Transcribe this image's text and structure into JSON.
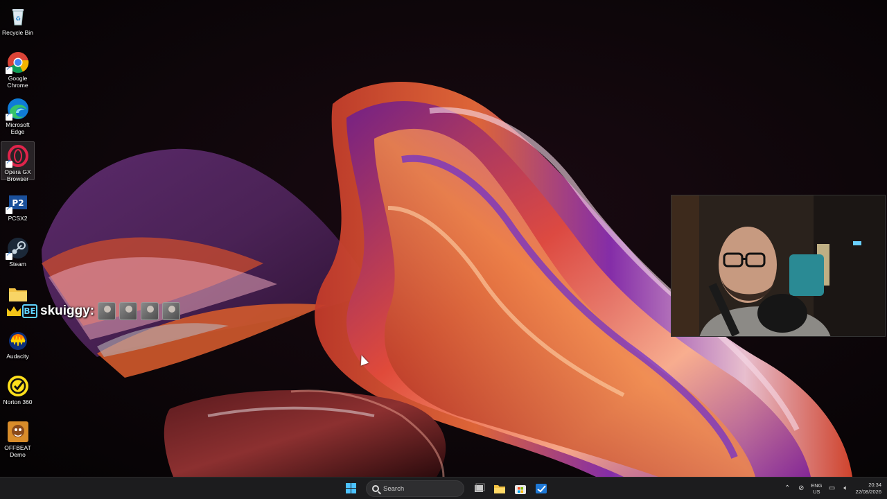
{
  "desktop": {
    "icons": [
      {
        "id": "recycle-bin",
        "label": "Recycle Bin",
        "icon": "recycle-bin-icon",
        "shortcut": false
      },
      {
        "id": "google-chrome",
        "label": "Google Chrome",
        "icon": "chrome-icon",
        "shortcut": true
      },
      {
        "id": "microsoft-edge",
        "label": "Microsoft Edge",
        "icon": "edge-icon",
        "shortcut": true
      },
      {
        "id": "opera-gx",
        "label": "Opera GX Browser",
        "icon": "opera-gx-icon",
        "shortcut": true,
        "selected": true
      },
      {
        "id": "pcsx2",
        "label": "PCSX2",
        "icon": "pcsx2-icon",
        "shortcut": true
      },
      {
        "id": "steam",
        "label": "Steam",
        "icon": "steam-icon",
        "shortcut": true
      },
      {
        "id": "folder",
        "label": "",
        "icon": "folder-icon",
        "shortcut": false
      },
      {
        "id": "audacity",
        "label": "Audacity",
        "icon": "audacity-icon",
        "shortcut": false
      },
      {
        "id": "norton-360",
        "label": "Norton 360",
        "icon": "norton-icon",
        "shortcut": false
      },
      {
        "id": "offbeat-demo",
        "label": "OFFBEAT Demo",
        "icon": "offbeat-icon",
        "shortcut": false
      }
    ]
  },
  "chat_overlay": {
    "badge_text": "BE",
    "username": "skuiggy:",
    "emote_count": 4
  },
  "taskbar": {
    "search_placeholder": "Search",
    "pinned": [
      "task-view-icon",
      "file-explorer-icon",
      "microsoft-store-icon",
      "app-icon"
    ],
    "tray": {
      "language_line1": "ENG",
      "language_line2": "US",
      "time": "20:34",
      "date": "22/08/2026"
    }
  },
  "colors": {
    "taskbar_bg": "#1c1c1e",
    "start_blue": "#4cc2ff",
    "accent_gold": "#f5c518",
    "badge_cyan": "#5fd3ff"
  }
}
